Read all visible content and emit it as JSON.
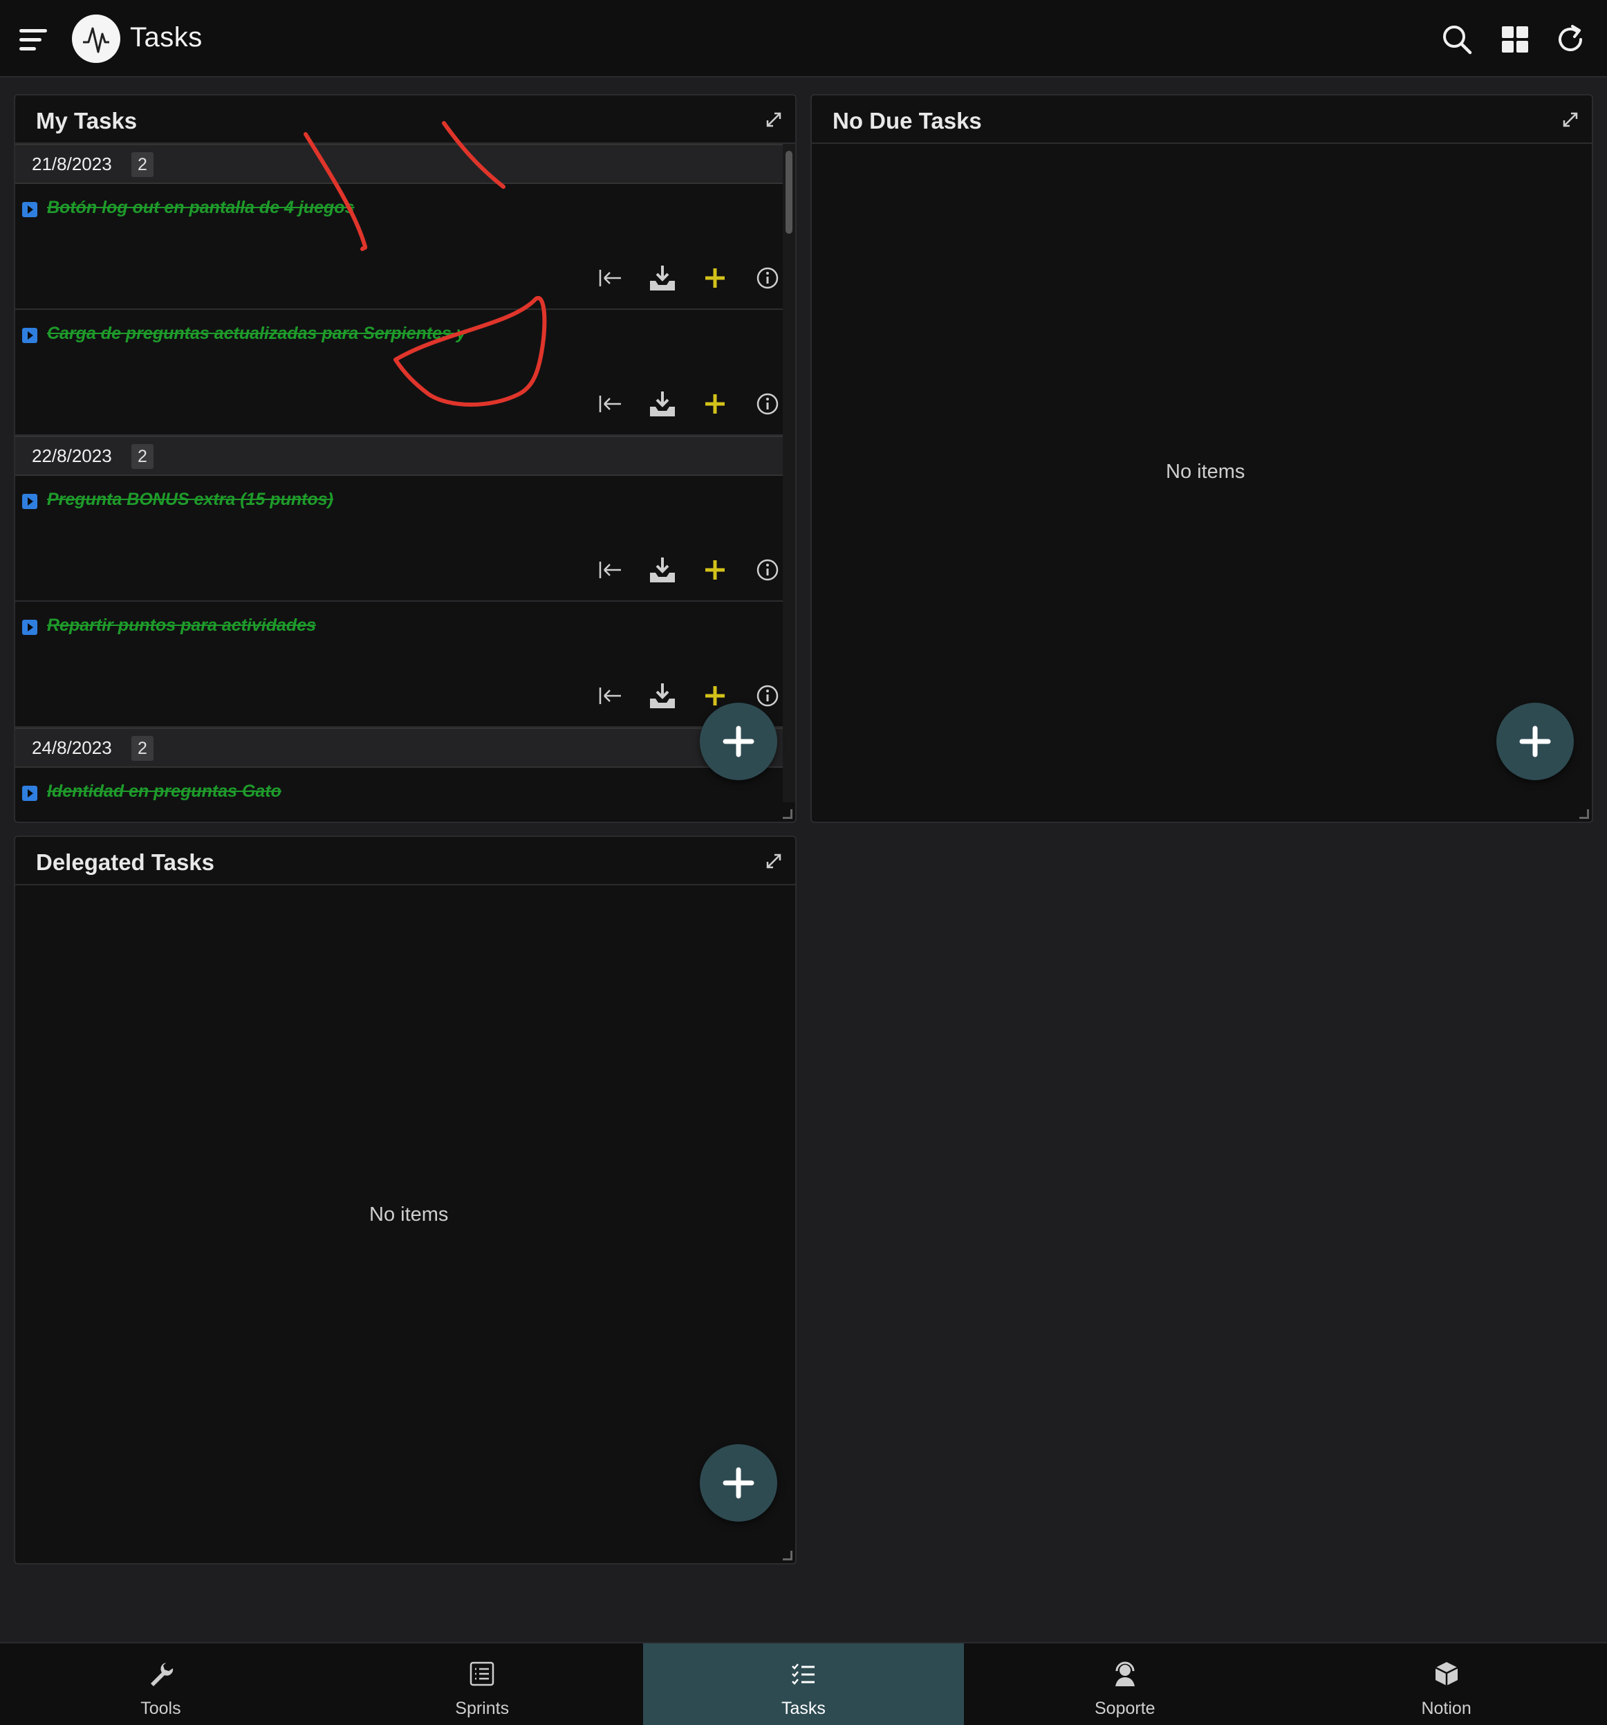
{
  "header": {
    "title": "Tasks"
  },
  "panels": {
    "my_tasks": {
      "title": "My Tasks",
      "groups": [
        {
          "date": "21/8/2023",
          "count": "2",
          "tasks": [
            {
              "title": "Botón log out en pantalla de 4 juegos"
            },
            {
              "title": "Carga de preguntas actualizadas para Serpientes y"
            }
          ]
        },
        {
          "date": "22/8/2023",
          "count": "2",
          "tasks": [
            {
              "title": "Pregunta BONUS extra (15 puntos)"
            },
            {
              "title": "Repartir puntos para actividades"
            }
          ]
        },
        {
          "date": "24/8/2023",
          "count": "2",
          "tasks": [
            {
              "title": "Identidad en preguntas Gato"
            }
          ]
        }
      ]
    },
    "no_due_tasks": {
      "title": "No Due Tasks",
      "empty": "No items"
    },
    "delegated_tasks": {
      "title": "Delegated Tasks",
      "empty": "No items"
    }
  },
  "bottom_nav": [
    {
      "label": "Tools",
      "icon": "wrench-icon"
    },
    {
      "label": "Sprints",
      "icon": "list-icon"
    },
    {
      "label": "Tasks",
      "icon": "checklist-icon",
      "active": true
    },
    {
      "label": "Soporte",
      "icon": "support-icon"
    },
    {
      "label": "Notion",
      "icon": "notion-icon"
    }
  ],
  "colors": {
    "background": "#1e1e20",
    "panel": "#111112",
    "task_done": "#1e9b2a",
    "fab": "#2f4b52",
    "accent_plus": "#d4c21b",
    "flag": "#2f7fe0",
    "annotation": "#e0352b"
  }
}
